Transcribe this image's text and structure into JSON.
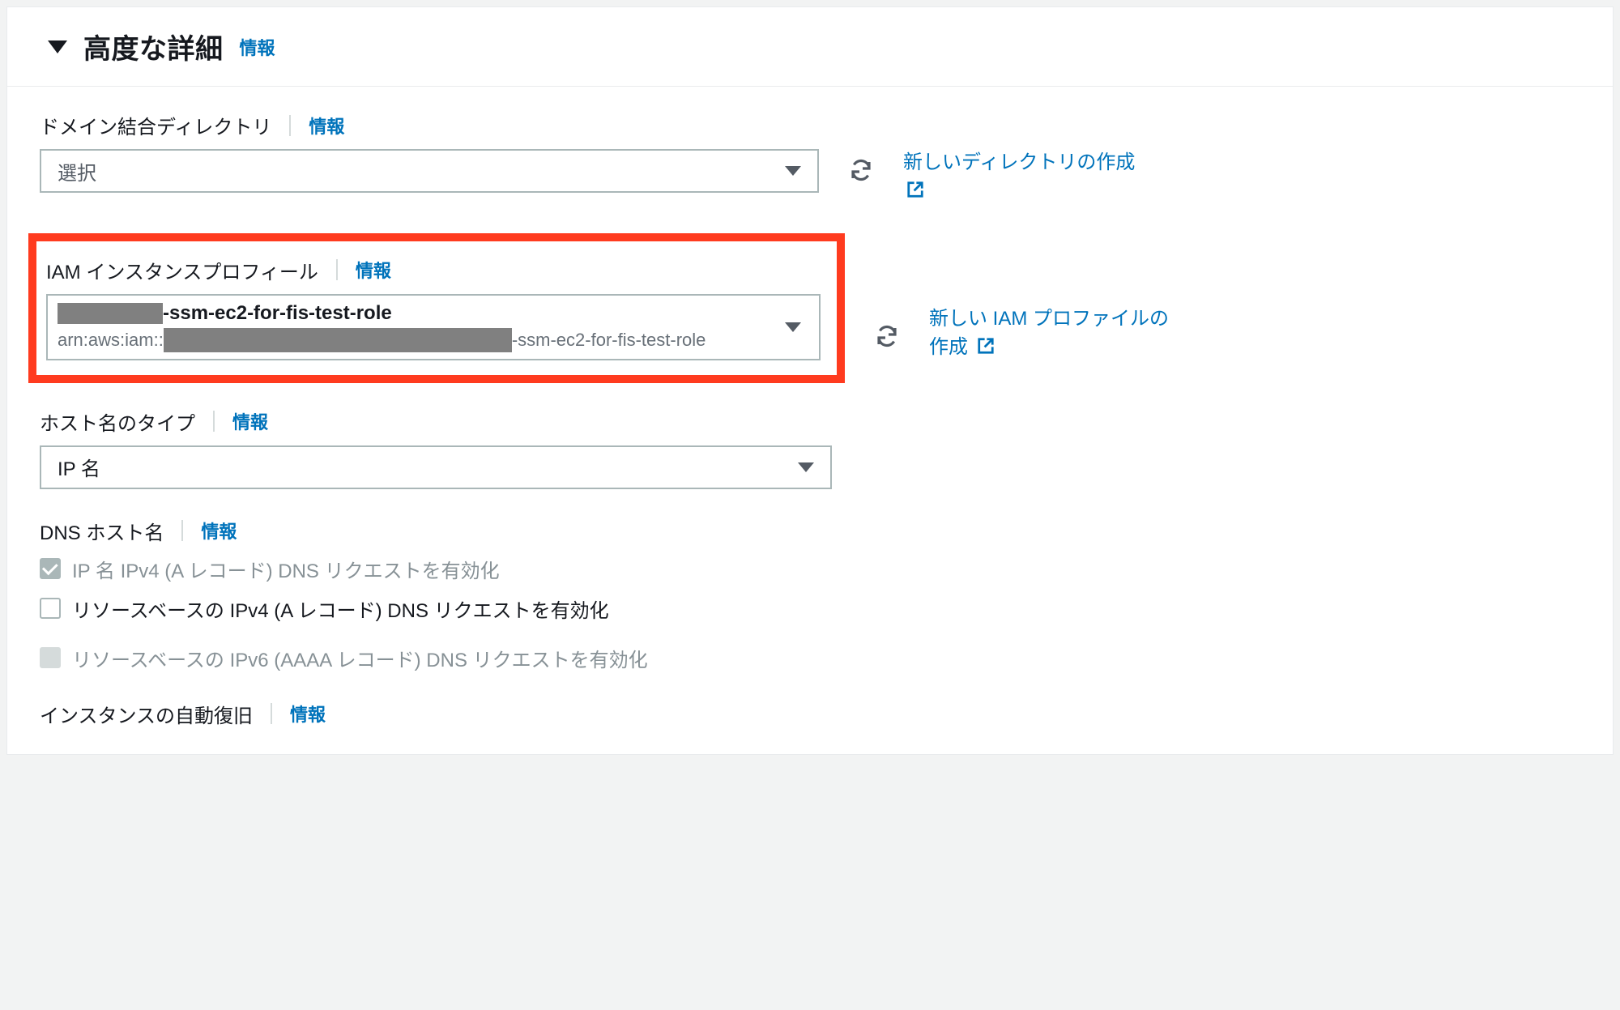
{
  "header": {
    "title": "高度な詳細",
    "info": "情報"
  },
  "domainDirectory": {
    "label": "ドメイン結合ディレクトリ",
    "info": "情報",
    "placeholder": "選択",
    "sideLink": "新しいディレクトリの作成"
  },
  "iamProfile": {
    "label": "IAM インスタンスプロフィール",
    "info": "情報",
    "valueSuffix": "-ssm-ec2-for-fis-test-role",
    "arnPrefix": "arn:aws:iam::",
    "arnSuffix": "-ssm-ec2-for-fis-test-role",
    "sideLink": "新しい IAM プロファイルの作成"
  },
  "hostnameType": {
    "label": "ホスト名のタイプ",
    "info": "情報",
    "value": "IP 名"
  },
  "dnsHostname": {
    "label": "DNS ホスト名",
    "info": "情報",
    "opt1": "IP 名 IPv4 (A レコード) DNS リクエストを有効化",
    "opt2": "リソースベースの IPv4 (A レコード) DNS リクエストを有効化",
    "opt3": "リソースベースの IPv6 (AAAA レコード) DNS リクエストを有効化"
  },
  "autoRecovery": {
    "label": "インスタンスの自動復旧",
    "info": "情報"
  }
}
